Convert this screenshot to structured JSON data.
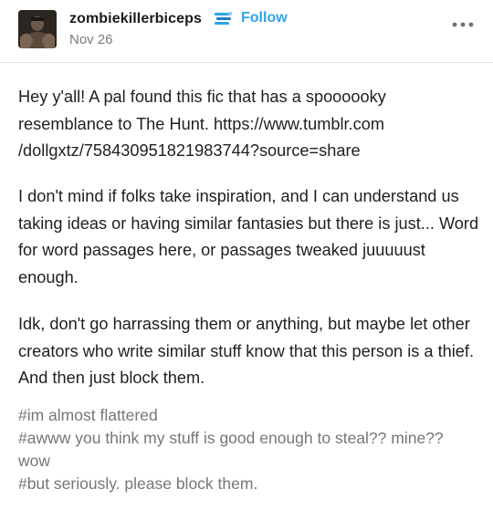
{
  "header": {
    "username": "zombiekillerbiceps",
    "follow_label": "Follow",
    "date": "Nov 26",
    "more_icon": "ellipsis-icon",
    "badge_icon": "stack-badge-icon",
    "accent_color": "#2da5e8"
  },
  "post": {
    "paragraphs": [
      "Hey y'all! A pal found this fic that has a spoooooky resemblance to The Hunt. https://www.tumblr.com /dollgxtz/758430951821983744?source=share",
      "I don't mind if folks take inspiration, and I can understand us taking ideas or having similar fantasies but there is just... Word for word passages here, or passages tweaked juuuuust enough.",
      "Idk, don't go harrassing them or anything, but maybe let other creators who write similar stuff know that this person is a thief. And then just block them."
    ],
    "tags": [
      "#im almost flattered",
      "#awww you think my stuff is good enough to steal?? mine?? wow",
      "#but seriously. please block them."
    ]
  }
}
